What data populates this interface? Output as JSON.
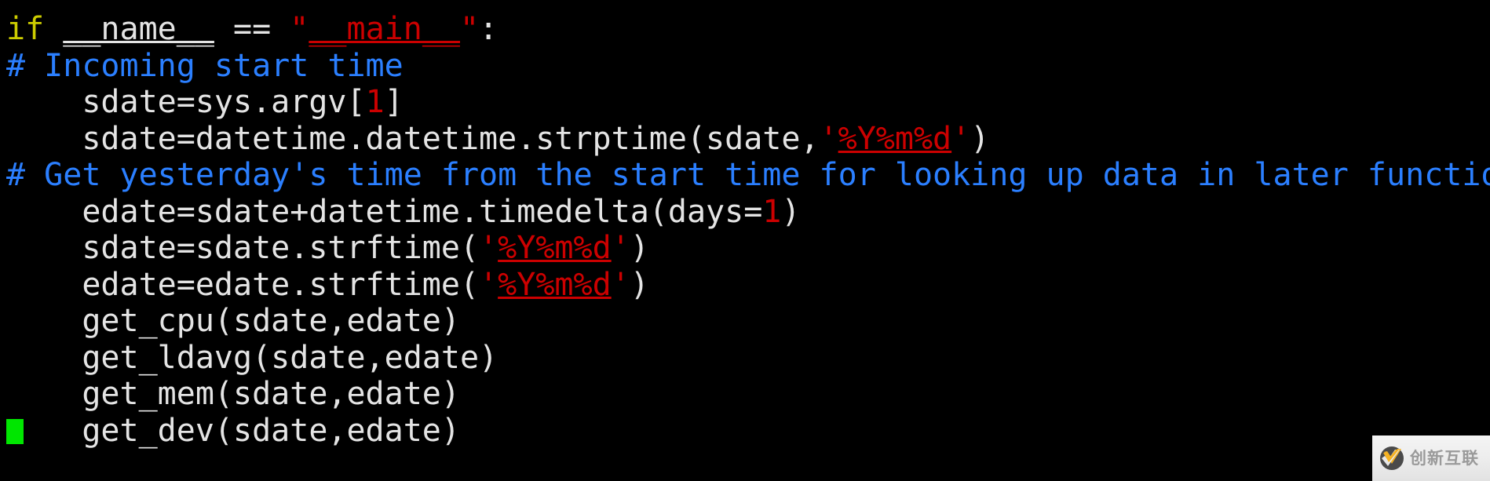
{
  "terminal": {
    "background_color": "#000000",
    "foreground_color": "#d8d8d8",
    "keyword_color": "#cdcd00",
    "comment_color": "#2b7fff",
    "string_color": "#cc0000",
    "number_color": "#cc0000",
    "cursor_color": "#00e600",
    "cursor_shape": "block"
  },
  "code": {
    "language": "python",
    "lines": [
      {
        "index": 1,
        "text": "if __name__ == \"__main__\":",
        "tokens": [
          {
            "t": "if",
            "k": "kw"
          },
          {
            "t": " ",
            "k": "plain"
          },
          {
            "t": "__name__",
            "k": "ul"
          },
          {
            "t": " == ",
            "k": "plain"
          },
          {
            "t": "\"",
            "k": "string"
          },
          {
            "t": "__main__",
            "k": "special"
          },
          {
            "t": "\"",
            "k": "string"
          },
          {
            "t": ":",
            "k": "plain"
          }
        ]
      },
      {
        "index": 2,
        "text": "# Incoming start time",
        "tokens": [
          {
            "t": "# Incoming start time",
            "k": "comment"
          }
        ]
      },
      {
        "index": 3,
        "text": "    sdate=sys.argv[1]",
        "tokens": [
          {
            "t": "    sdate=sys.argv[",
            "k": "plain"
          },
          {
            "t": "1",
            "k": "number"
          },
          {
            "t": "]",
            "k": "plain"
          }
        ]
      },
      {
        "index": 4,
        "text": "    sdate=datetime.datetime.strptime(sdate,'%Y%m%d')",
        "tokens": [
          {
            "t": "    sdate=datetime.datetime.strptime(sdate,",
            "k": "plain"
          },
          {
            "t": "'",
            "k": "string"
          },
          {
            "t": "%Y%m%d",
            "k": "special"
          },
          {
            "t": "'",
            "k": "string"
          },
          {
            "t": ")",
            "k": "plain"
          }
        ]
      },
      {
        "index": 5,
        "text": "# Get yesterday's time from the start time for looking up data in later functions",
        "tokens": [
          {
            "t": "# Get yesterday's time from the start time for looking up data in later functions",
            "k": "comment"
          }
        ]
      },
      {
        "index": 6,
        "text": "    edate=sdate+datetime.timedelta(days=1)",
        "tokens": [
          {
            "t": "    edate=sdate+datetime.timedelta(days=",
            "k": "plain"
          },
          {
            "t": "1",
            "k": "number"
          },
          {
            "t": ")",
            "k": "plain"
          }
        ]
      },
      {
        "index": 7,
        "text": "    sdate=sdate.strftime('%Y%m%d')",
        "tokens": [
          {
            "t": "    sdate=sdate.strftime(",
            "k": "plain"
          },
          {
            "t": "'",
            "k": "string"
          },
          {
            "t": "%Y%m%d",
            "k": "special"
          },
          {
            "t": "'",
            "k": "string"
          },
          {
            "t": ")",
            "k": "plain"
          }
        ]
      },
      {
        "index": 8,
        "text": "    edate=edate.strftime('%Y%m%d')",
        "tokens": [
          {
            "t": "    edate=edate.strftime(",
            "k": "plain"
          },
          {
            "t": "'",
            "k": "string"
          },
          {
            "t": "%Y%m%d",
            "k": "special"
          },
          {
            "t": "'",
            "k": "string"
          },
          {
            "t": ")",
            "k": "plain"
          }
        ]
      },
      {
        "index": 9,
        "text": "    get_cpu(sdate,edate)",
        "tokens": [
          {
            "t": "    get_cpu(sdate,edate)",
            "k": "plain"
          }
        ]
      },
      {
        "index": 10,
        "text": "    get_ldavg(sdate,edate)",
        "tokens": [
          {
            "t": "    get_ldavg(sdate,edate)",
            "k": "plain"
          }
        ]
      },
      {
        "index": 11,
        "text": "    get_mem(sdate,edate)",
        "tokens": [
          {
            "t": "    get_mem(sdate,edate)",
            "k": "plain"
          }
        ]
      },
      {
        "index": 12,
        "text": "    get_dev(sdate,edate)",
        "cursor": true,
        "tokens": [
          {
            "t": "    get_dev(sdate,edate)",
            "k": "plain"
          }
        ]
      }
    ]
  },
  "watermark": {
    "text": "创新互联",
    "logo_colors": {
      "swoosh": "#f5b223",
      "check": "#5a5a5a"
    }
  }
}
